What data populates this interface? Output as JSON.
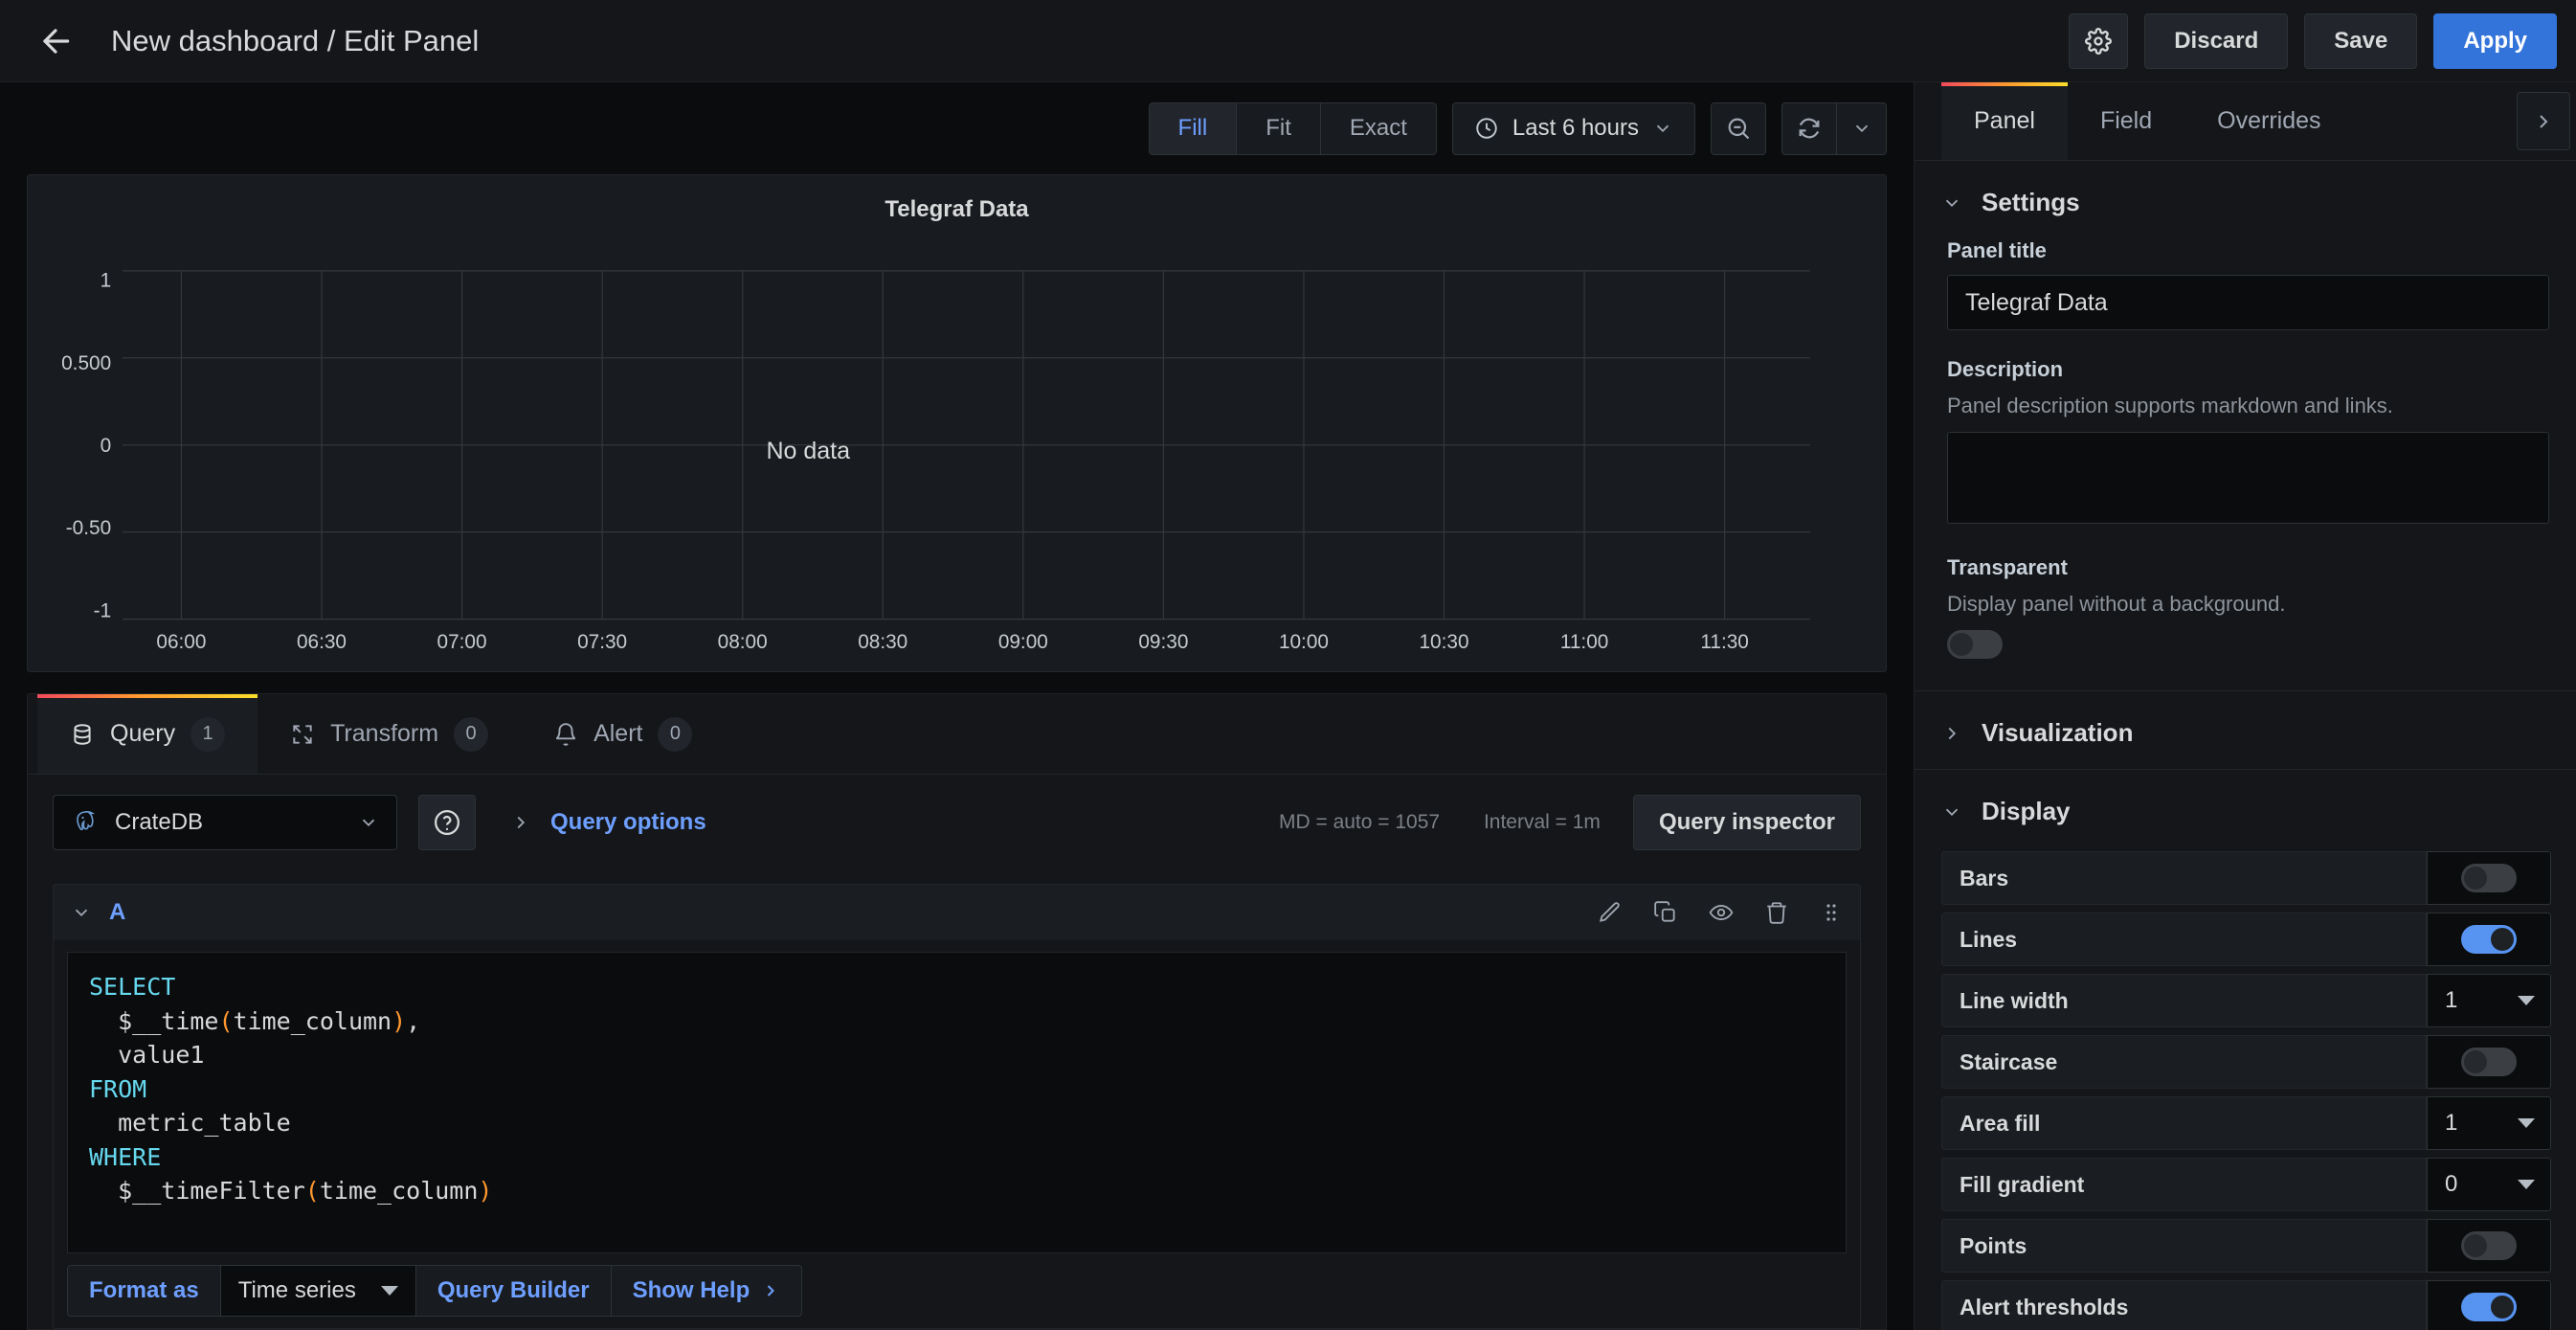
{
  "header": {
    "back_icon": "arrow-left-icon",
    "title": "New dashboard / Edit Panel",
    "settings_icon": "gear-icon",
    "discard_label": "Discard",
    "save_label": "Save",
    "apply_label": "Apply",
    "accent_primary": "#3274d9"
  },
  "viz_toolbar": {
    "fit_modes": [
      {
        "label": "Fill",
        "active": true
      },
      {
        "label": "Fit",
        "active": false
      },
      {
        "label": "Exact",
        "active": false
      }
    ],
    "time_range": "Last 6 hours",
    "clock_icon": "clock-icon",
    "zoom_out_icon": "zoom-out-icon",
    "refresh_icon": "refresh-icon",
    "refresh_caret_icon": "chevron-down-icon",
    "time_caret_icon": "chevron-down-icon"
  },
  "panel": {
    "title": "Telegraf Data",
    "no_data_text": "No data"
  },
  "chart_data": {
    "type": "line",
    "title": "Telegraf Data",
    "xlabel": "",
    "ylabel": "",
    "series": [],
    "x_tick_labels": [
      "06:00",
      "06:30",
      "07:00",
      "07:30",
      "08:00",
      "08:30",
      "09:00",
      "09:30",
      "10:00",
      "10:30",
      "11:00",
      "11:30"
    ],
    "y_tick_labels": [
      "1",
      "0.500",
      "0",
      "-0.50",
      "-1"
    ],
    "y_tick_values": [
      1,
      0.5,
      0,
      -0.5,
      -1
    ],
    "ylim": [
      -1,
      1
    ],
    "grid": true,
    "legend": "none",
    "annotation": "No data",
    "empty": true
  },
  "query_pane": {
    "tabs": [
      {
        "label": "Query",
        "badge": "1",
        "icon": "database-icon",
        "active": true
      },
      {
        "label": "Transform",
        "badge": "0",
        "icon": "transform-icon",
        "active": false
      },
      {
        "label": "Alert",
        "badge": "0",
        "icon": "bell-icon",
        "active": false
      }
    ],
    "datasource": {
      "name": "CrateDB",
      "icon": "postgres-elephant-icon",
      "caret_icon": "chevron-down-icon"
    },
    "help_icon": "question-circle-icon",
    "query_options_label": "Query options",
    "query_options_chevron": "chevron-right-icon",
    "meta_md": "MD = auto = 1057",
    "meta_interval": "Interval = 1m",
    "inspector_label": "Query inspector",
    "query_row": {
      "ref_id": "A",
      "collapse_icon": "chevron-down-icon",
      "actions": [
        "pencil-icon",
        "copy-icon",
        "eye-icon",
        "trash-icon",
        "drag-handle-icon"
      ]
    },
    "sql": {
      "line1_kw": "SELECT",
      "line2": "$__time(time_column),",
      "line3": "value1",
      "line4_kw": "FROM",
      "line5": "metric_table",
      "line6_kw": "WHERE",
      "line7": "$__timeFilter(time_column)"
    },
    "footer": {
      "format_as_label": "Format as",
      "format_value": "Time series",
      "query_builder_label": "Query Builder",
      "show_help_label": "Show Help",
      "show_help_chevron": "chevron-right-icon"
    }
  },
  "options": {
    "tabs": [
      {
        "label": "Panel",
        "active": true
      },
      {
        "label": "Field",
        "active": false
      },
      {
        "label": "Overrides",
        "active": false
      }
    ],
    "collapse_icon": "chevron-right-icon",
    "settings": {
      "section_label": "Settings",
      "expanded": true,
      "panel_title_label": "Panel title",
      "panel_title_value": "Telegraf Data",
      "description_label": "Description",
      "description_help": "Panel description supports markdown and links.",
      "description_value": "",
      "transparent_label": "Transparent",
      "transparent_help": "Display panel without a background.",
      "transparent_on": false
    },
    "visualization": {
      "section_label": "Visualization",
      "expanded": false
    },
    "display": {
      "section_label": "Display",
      "expanded": true,
      "rows": [
        {
          "name": "Bars",
          "type": "toggle",
          "value": "off"
        },
        {
          "name": "Lines",
          "type": "toggle",
          "value": "on"
        },
        {
          "name": "Line width",
          "type": "select",
          "value": "1"
        },
        {
          "name": "Staircase",
          "type": "toggle",
          "value": "off"
        },
        {
          "name": "Area fill",
          "type": "select",
          "value": "1"
        },
        {
          "name": "Fill gradient",
          "type": "select",
          "value": "0"
        },
        {
          "name": "Points",
          "type": "toggle",
          "value": "off"
        },
        {
          "name": "Alert thresholds",
          "type": "toggle",
          "value": "on"
        }
      ]
    }
  }
}
